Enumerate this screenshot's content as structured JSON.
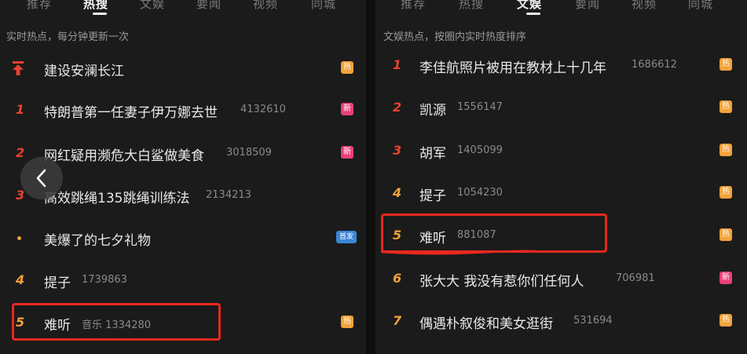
{
  "left": {
    "tabs": [
      {
        "label": "推荐",
        "active": false
      },
      {
        "label": "热搜",
        "active": true
      },
      {
        "label": "文娱",
        "active": false
      },
      {
        "label": "要闻",
        "active": false
      },
      {
        "label": "视频",
        "active": false
      },
      {
        "label": "同城",
        "active": false
      }
    ],
    "subtitle": "实时热点，每分钟更新一次",
    "items": [
      {
        "rank": "",
        "rank_icon": "pin-icon",
        "title": "建设安澜长江",
        "meta": "",
        "badge": "热",
        "badge_type": "hot"
      },
      {
        "rank": "1",
        "title": "特朗普第一任妻子伊万娜去世",
        "meta": "4132610",
        "badge": "新",
        "badge_type": "new"
      },
      {
        "rank": "2",
        "title": "网红疑用濒危大白鲨做美食",
        "meta": "3018509",
        "badge": "新",
        "badge_type": "new"
      },
      {
        "rank": "3",
        "title": "高效跳绳135跳绳训练法",
        "meta": "2134213",
        "badge": "",
        "badge_type": ""
      },
      {
        "rank": "",
        "rank_icon": "dot-icon",
        "title": "美爆了的七夕礼物",
        "meta": "",
        "badge": "首发",
        "badge_type": "premiere"
      },
      {
        "rank": "4",
        "title": "提子",
        "meta": "1739863",
        "badge": "",
        "badge_type": ""
      },
      {
        "rank": "5",
        "title": "难听",
        "meta": "音乐 1334280",
        "badge": "热",
        "badge_type": "hot"
      }
    ]
  },
  "right": {
    "tabs": [
      {
        "label": "推荐",
        "active": false
      },
      {
        "label": "热搜",
        "active": false
      },
      {
        "label": "文娱",
        "active": true
      },
      {
        "label": "要闻",
        "active": false
      },
      {
        "label": "视频",
        "active": false
      },
      {
        "label": "同城",
        "active": false
      }
    ],
    "subtitle": "文娱热点，按圈内实时热度排序",
    "items": [
      {
        "rank": "1",
        "title": "李佳航照片被用在教材上十几年",
        "meta": "1686612",
        "badge": "热",
        "badge_type": "hot"
      },
      {
        "rank": "2",
        "title": "凯源",
        "meta": "1556147",
        "badge": "热",
        "badge_type": "hot"
      },
      {
        "rank": "3",
        "title": "胡军",
        "meta": "1405099",
        "badge": "热",
        "badge_type": "hot"
      },
      {
        "rank": "4",
        "title": "提子",
        "meta": "1054230",
        "badge": "热",
        "badge_type": "hot"
      },
      {
        "rank": "5",
        "title": "难听",
        "meta": "881087",
        "badge": "热",
        "badge_type": "hot"
      },
      {
        "rank": "6",
        "title": "张大大 我没有惹你们任何人",
        "meta": "706981",
        "badge": "新",
        "badge_type": "new"
      },
      {
        "rank": "7",
        "title": "偶遇朴叙俊和美女逛街",
        "meta": "531694",
        "badge": "热",
        "badge_type": "hot"
      }
    ]
  },
  "colors": {
    "rank_top3": "#e8412f",
    "rank_other": "#f1a23a",
    "hot_badge": "#f1a23a",
    "new_badge": "#e8417a",
    "premiere_badge": "#3b86d6",
    "annotation": "#e8281e"
  },
  "icons": {
    "back": "chevron-left-icon",
    "pin": "pin-top-icon"
  }
}
